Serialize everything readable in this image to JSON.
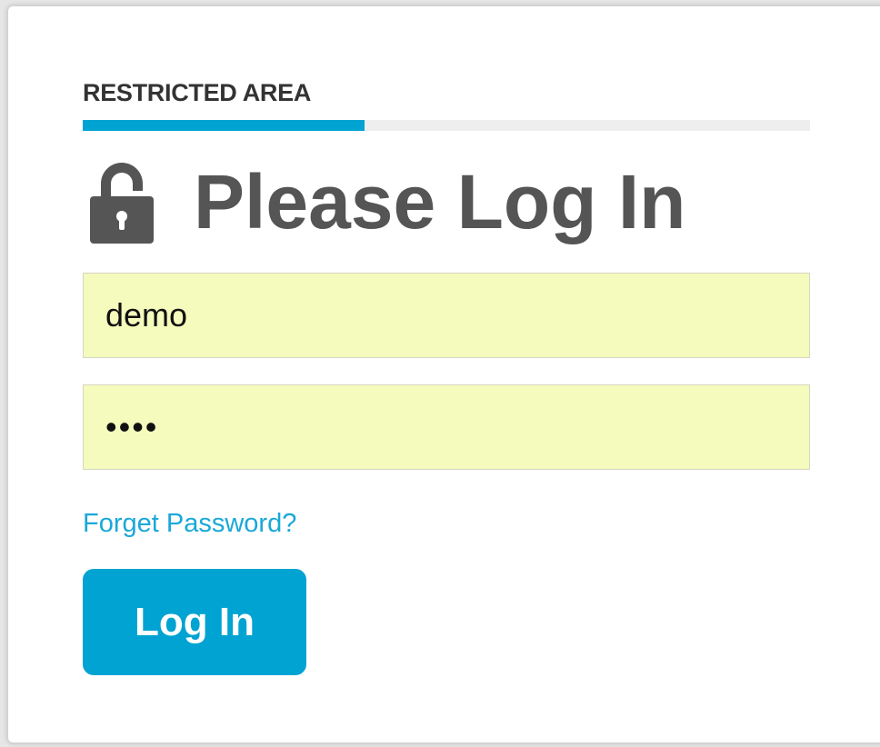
{
  "panel": {
    "section_title": "RESTRICTED AREA",
    "heading": "Please Log In",
    "heading_icon": "lock-icon"
  },
  "form": {
    "username_value": "demo",
    "password_value": "demo",
    "forgot_link_label": "Forget Password?",
    "submit_label": "Log In"
  },
  "colors": {
    "accent": "#00a3d2",
    "link": "#1aa8d8",
    "field_background": "#f4fbbc",
    "heading": "#555555"
  }
}
